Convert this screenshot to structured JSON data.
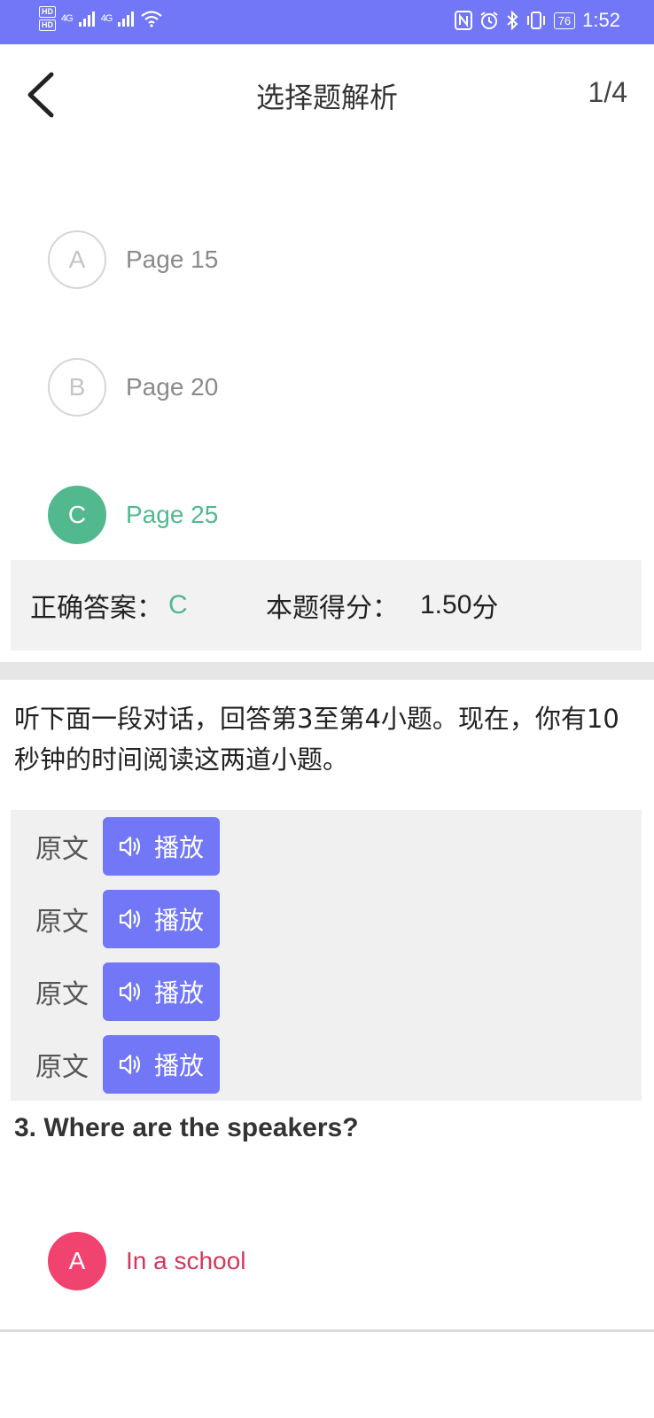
{
  "status_bar": {
    "hd_top": "HD",
    "hd_bottom": "HD",
    "signal1": "4G",
    "signal2": "4G",
    "battery": "76",
    "time": "1:52"
  },
  "header": {
    "title": "选择题解析",
    "counter": "1/4"
  },
  "prev_question": {
    "options": [
      {
        "letter": "A",
        "text": "Page 15",
        "state": "normal"
      },
      {
        "letter": "B",
        "text": "Page 20",
        "state": "normal"
      },
      {
        "letter": "C",
        "text": "Page 25",
        "state": "correct"
      }
    ],
    "correct_answer_label": "正确答案：",
    "correct_answer": "C",
    "score_label": "本题得分：",
    "score_value": "1.50",
    "score_unit": "分"
  },
  "instruction": "听下面一段对话，回答第3至第4小题。现在，你有10秒钟的时间阅读这两道小题。",
  "audio_items": [
    {
      "label": "原文",
      "button": "播放"
    },
    {
      "label": "原文",
      "button": "播放"
    },
    {
      "label": "原文",
      "button": "播放"
    },
    {
      "label": "原文",
      "button": "播放"
    }
  ],
  "question": {
    "title": "3. Where are the speakers?",
    "options": [
      {
        "letter": "A",
        "text": "In a school",
        "state": "wrong"
      }
    ]
  },
  "colors": {
    "accent": "#7177f6",
    "correct": "#52b98f",
    "wrong": "#f1436f"
  }
}
